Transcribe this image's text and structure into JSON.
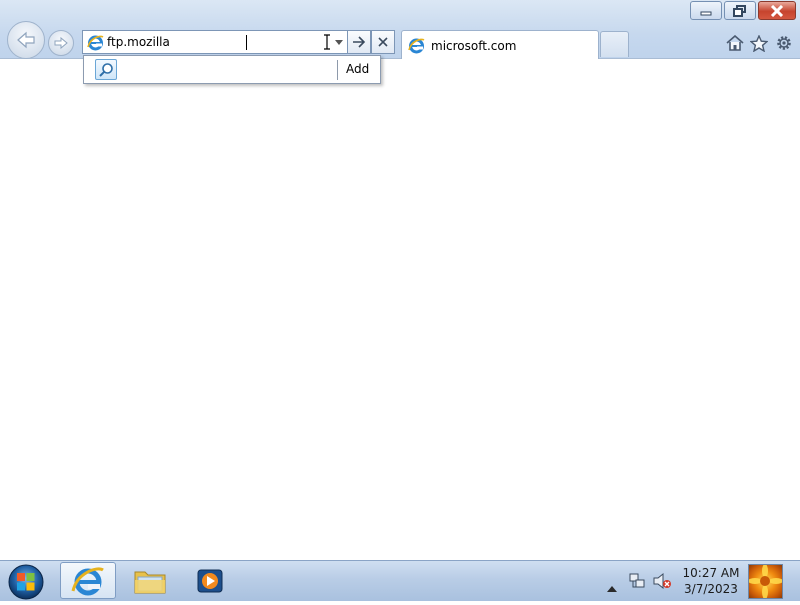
{
  "browser": {
    "address": {
      "value": "ftp.mozilla",
      "icon": "ie-page-icon"
    },
    "tab": {
      "label": "microsoft.com",
      "icon": "ie-page-icon"
    },
    "autocomplete": {
      "add_label": "Add"
    },
    "toolbar_icons": [
      "home-icon",
      "favorites-star-icon",
      "tools-gear-icon"
    ],
    "window_controls": [
      "minimize-icon",
      "restore-icon",
      "close-icon"
    ]
  },
  "taskbar": {
    "pinned": [
      "internet-explorer",
      "windows-explorer",
      "windows-media-player"
    ],
    "active": "internet-explorer",
    "clock": {
      "time": "10:27 AM",
      "date": "3/7/2023"
    }
  },
  "colors": {
    "chrome": "#c6d8ee",
    "close_button": "#c6442e",
    "taskbar": "#b9cde6"
  }
}
